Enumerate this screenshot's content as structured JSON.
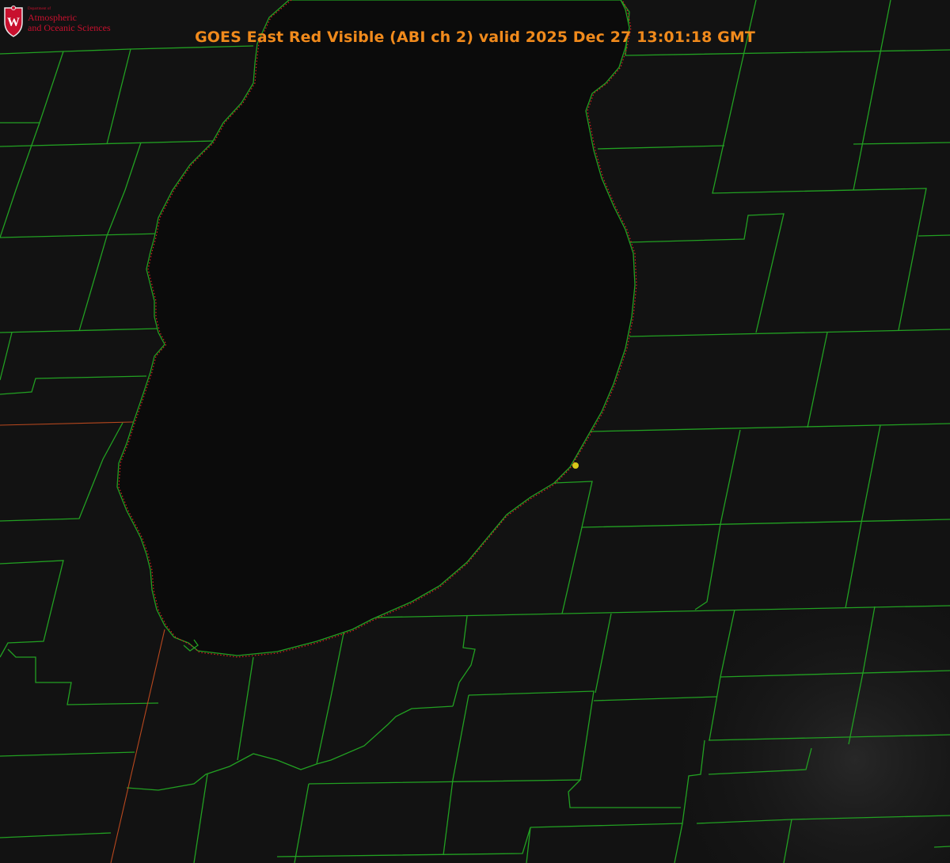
{
  "header": {
    "title": "GOES East Red Visible (ABI ch 2) valid 2025 Dec 27 13:01:18 GMT"
  },
  "logo": {
    "department_small": "Department of",
    "line1": "Atmospheric",
    "line2": "and Oceanic Sciences",
    "shield_letter": "W"
  },
  "colors": {
    "background": "#121212",
    "lake": "#0b0b0b",
    "county_lines": "#22a022",
    "shoreline_highres": "#d92020",
    "state_line": "#b8481e",
    "title": "#f08a1c",
    "logo": "#c8102e",
    "marker": "#d8c81a"
  },
  "map": {
    "type": "satellite-visible-image",
    "features": [
      "lake-michigan-southern-basin",
      "county-boundaries",
      "state-boundary",
      "location-marker"
    ]
  }
}
